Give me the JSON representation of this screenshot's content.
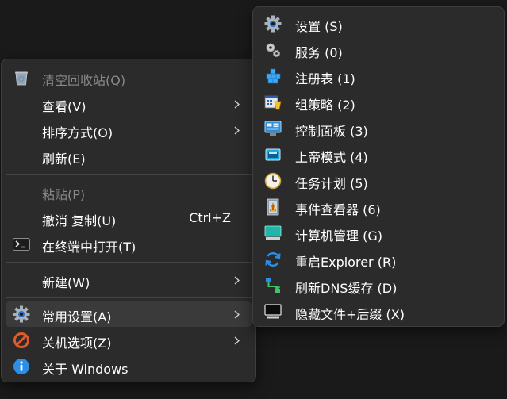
{
  "main_menu": {
    "items": [
      {
        "label": "清空回收站(Q)",
        "icon": "recycle-bin-icon"
      },
      {
        "label": "查看(V)"
      },
      {
        "label": "排序方式(O)"
      },
      {
        "label": "刷新(E)"
      },
      {
        "label": "粘贴(P)"
      },
      {
        "label": "撤消 复制(U)",
        "accel": "Ctrl+Z"
      },
      {
        "label": "在终端中打开(T)",
        "icon": "terminal-icon"
      },
      {
        "label": "新建(W)"
      },
      {
        "label": "常用设置(A)",
        "icon": "gear-icon"
      },
      {
        "label": "关机选项(Z)",
        "icon": "prohibited-icon"
      },
      {
        "label": "关于 Windows",
        "icon": "info-icon"
      }
    ]
  },
  "sub_menu": {
    "items": [
      {
        "label": "设置 (S)",
        "icon": "gear-icon"
      },
      {
        "label": "服务 (0)",
        "icon": "services-gears-icon"
      },
      {
        "label": "注册表 (1)",
        "icon": "registry-icon"
      },
      {
        "label": "组策略 (2)",
        "icon": "group-policy-icon"
      },
      {
        "label": "控制面板 (3)",
        "icon": "control-panel-icon"
      },
      {
        "label": "上帝模式 (4)",
        "icon": "god-mode-icon"
      },
      {
        "label": "任务计划 (5)",
        "icon": "clock-icon"
      },
      {
        "label": "事件查看器 (6)",
        "icon": "event-viewer-icon"
      },
      {
        "label": "计算机管理 (G)",
        "icon": "computer-icon"
      },
      {
        "label": "重启Explorer (R)",
        "icon": "refresh-icon"
      },
      {
        "label": "刷新DNS缓存 (D)",
        "icon": "dns-icon"
      },
      {
        "label": "隐藏文件+后缀 (X)",
        "icon": "monitor-icon"
      }
    ]
  },
  "colors": {
    "menu_bg": "#2b2b2b",
    "hover_bg": "#3a3a3a",
    "disabled_text": "#8a8a8a",
    "accent_blue": "#2b8fe8",
    "prohibited_red": "#e05a2a"
  }
}
